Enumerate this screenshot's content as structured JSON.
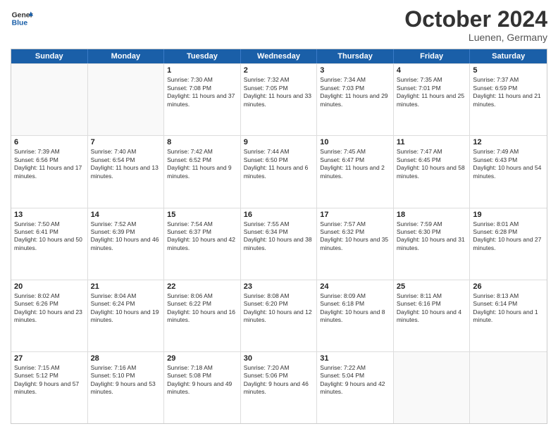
{
  "header": {
    "logo_general": "General",
    "logo_blue": "Blue",
    "month": "October 2024",
    "location": "Luenen, Germany"
  },
  "days_of_week": [
    "Sunday",
    "Monday",
    "Tuesday",
    "Wednesday",
    "Thursday",
    "Friday",
    "Saturday"
  ],
  "rows": [
    [
      {
        "day": "",
        "empty": true
      },
      {
        "day": "",
        "empty": true
      },
      {
        "day": "1",
        "sunrise": "Sunrise: 7:30 AM",
        "sunset": "Sunset: 7:08 PM",
        "daylight": "Daylight: 11 hours and 37 minutes."
      },
      {
        "day": "2",
        "sunrise": "Sunrise: 7:32 AM",
        "sunset": "Sunset: 7:05 PM",
        "daylight": "Daylight: 11 hours and 33 minutes."
      },
      {
        "day": "3",
        "sunrise": "Sunrise: 7:34 AM",
        "sunset": "Sunset: 7:03 PM",
        "daylight": "Daylight: 11 hours and 29 minutes."
      },
      {
        "day": "4",
        "sunrise": "Sunrise: 7:35 AM",
        "sunset": "Sunset: 7:01 PM",
        "daylight": "Daylight: 11 hours and 25 minutes."
      },
      {
        "day": "5",
        "sunrise": "Sunrise: 7:37 AM",
        "sunset": "Sunset: 6:59 PM",
        "daylight": "Daylight: 11 hours and 21 minutes."
      }
    ],
    [
      {
        "day": "6",
        "sunrise": "Sunrise: 7:39 AM",
        "sunset": "Sunset: 6:56 PM",
        "daylight": "Daylight: 11 hours and 17 minutes."
      },
      {
        "day": "7",
        "sunrise": "Sunrise: 7:40 AM",
        "sunset": "Sunset: 6:54 PM",
        "daylight": "Daylight: 11 hours and 13 minutes."
      },
      {
        "day": "8",
        "sunrise": "Sunrise: 7:42 AM",
        "sunset": "Sunset: 6:52 PM",
        "daylight": "Daylight: 11 hours and 9 minutes."
      },
      {
        "day": "9",
        "sunrise": "Sunrise: 7:44 AM",
        "sunset": "Sunset: 6:50 PM",
        "daylight": "Daylight: 11 hours and 6 minutes."
      },
      {
        "day": "10",
        "sunrise": "Sunrise: 7:45 AM",
        "sunset": "Sunset: 6:47 PM",
        "daylight": "Daylight: 11 hours and 2 minutes."
      },
      {
        "day": "11",
        "sunrise": "Sunrise: 7:47 AM",
        "sunset": "Sunset: 6:45 PM",
        "daylight": "Daylight: 10 hours and 58 minutes."
      },
      {
        "day": "12",
        "sunrise": "Sunrise: 7:49 AM",
        "sunset": "Sunset: 6:43 PM",
        "daylight": "Daylight: 10 hours and 54 minutes."
      }
    ],
    [
      {
        "day": "13",
        "sunrise": "Sunrise: 7:50 AM",
        "sunset": "Sunset: 6:41 PM",
        "daylight": "Daylight: 10 hours and 50 minutes."
      },
      {
        "day": "14",
        "sunrise": "Sunrise: 7:52 AM",
        "sunset": "Sunset: 6:39 PM",
        "daylight": "Daylight: 10 hours and 46 minutes."
      },
      {
        "day": "15",
        "sunrise": "Sunrise: 7:54 AM",
        "sunset": "Sunset: 6:37 PM",
        "daylight": "Daylight: 10 hours and 42 minutes."
      },
      {
        "day": "16",
        "sunrise": "Sunrise: 7:55 AM",
        "sunset": "Sunset: 6:34 PM",
        "daylight": "Daylight: 10 hours and 38 minutes."
      },
      {
        "day": "17",
        "sunrise": "Sunrise: 7:57 AM",
        "sunset": "Sunset: 6:32 PM",
        "daylight": "Daylight: 10 hours and 35 minutes."
      },
      {
        "day": "18",
        "sunrise": "Sunrise: 7:59 AM",
        "sunset": "Sunset: 6:30 PM",
        "daylight": "Daylight: 10 hours and 31 minutes."
      },
      {
        "day": "19",
        "sunrise": "Sunrise: 8:01 AM",
        "sunset": "Sunset: 6:28 PM",
        "daylight": "Daylight: 10 hours and 27 minutes."
      }
    ],
    [
      {
        "day": "20",
        "sunrise": "Sunrise: 8:02 AM",
        "sunset": "Sunset: 6:26 PM",
        "daylight": "Daylight: 10 hours and 23 minutes."
      },
      {
        "day": "21",
        "sunrise": "Sunrise: 8:04 AM",
        "sunset": "Sunset: 6:24 PM",
        "daylight": "Daylight: 10 hours and 19 minutes."
      },
      {
        "day": "22",
        "sunrise": "Sunrise: 8:06 AM",
        "sunset": "Sunset: 6:22 PM",
        "daylight": "Daylight: 10 hours and 16 minutes."
      },
      {
        "day": "23",
        "sunrise": "Sunrise: 8:08 AM",
        "sunset": "Sunset: 6:20 PM",
        "daylight": "Daylight: 10 hours and 12 minutes."
      },
      {
        "day": "24",
        "sunrise": "Sunrise: 8:09 AM",
        "sunset": "Sunset: 6:18 PM",
        "daylight": "Daylight: 10 hours and 8 minutes."
      },
      {
        "day": "25",
        "sunrise": "Sunrise: 8:11 AM",
        "sunset": "Sunset: 6:16 PM",
        "daylight": "Daylight: 10 hours and 4 minutes."
      },
      {
        "day": "26",
        "sunrise": "Sunrise: 8:13 AM",
        "sunset": "Sunset: 6:14 PM",
        "daylight": "Daylight: 10 hours and 1 minute."
      }
    ],
    [
      {
        "day": "27",
        "sunrise": "Sunrise: 7:15 AM",
        "sunset": "Sunset: 5:12 PM",
        "daylight": "Daylight: 9 hours and 57 minutes."
      },
      {
        "day": "28",
        "sunrise": "Sunrise: 7:16 AM",
        "sunset": "Sunset: 5:10 PM",
        "daylight": "Daylight: 9 hours and 53 minutes."
      },
      {
        "day": "29",
        "sunrise": "Sunrise: 7:18 AM",
        "sunset": "Sunset: 5:08 PM",
        "daylight": "Daylight: 9 hours and 49 minutes."
      },
      {
        "day": "30",
        "sunrise": "Sunrise: 7:20 AM",
        "sunset": "Sunset: 5:06 PM",
        "daylight": "Daylight: 9 hours and 46 minutes."
      },
      {
        "day": "31",
        "sunrise": "Sunrise: 7:22 AM",
        "sunset": "Sunset: 5:04 PM",
        "daylight": "Daylight: 9 hours and 42 minutes."
      },
      {
        "day": "",
        "empty": true
      },
      {
        "day": "",
        "empty": true
      }
    ]
  ]
}
